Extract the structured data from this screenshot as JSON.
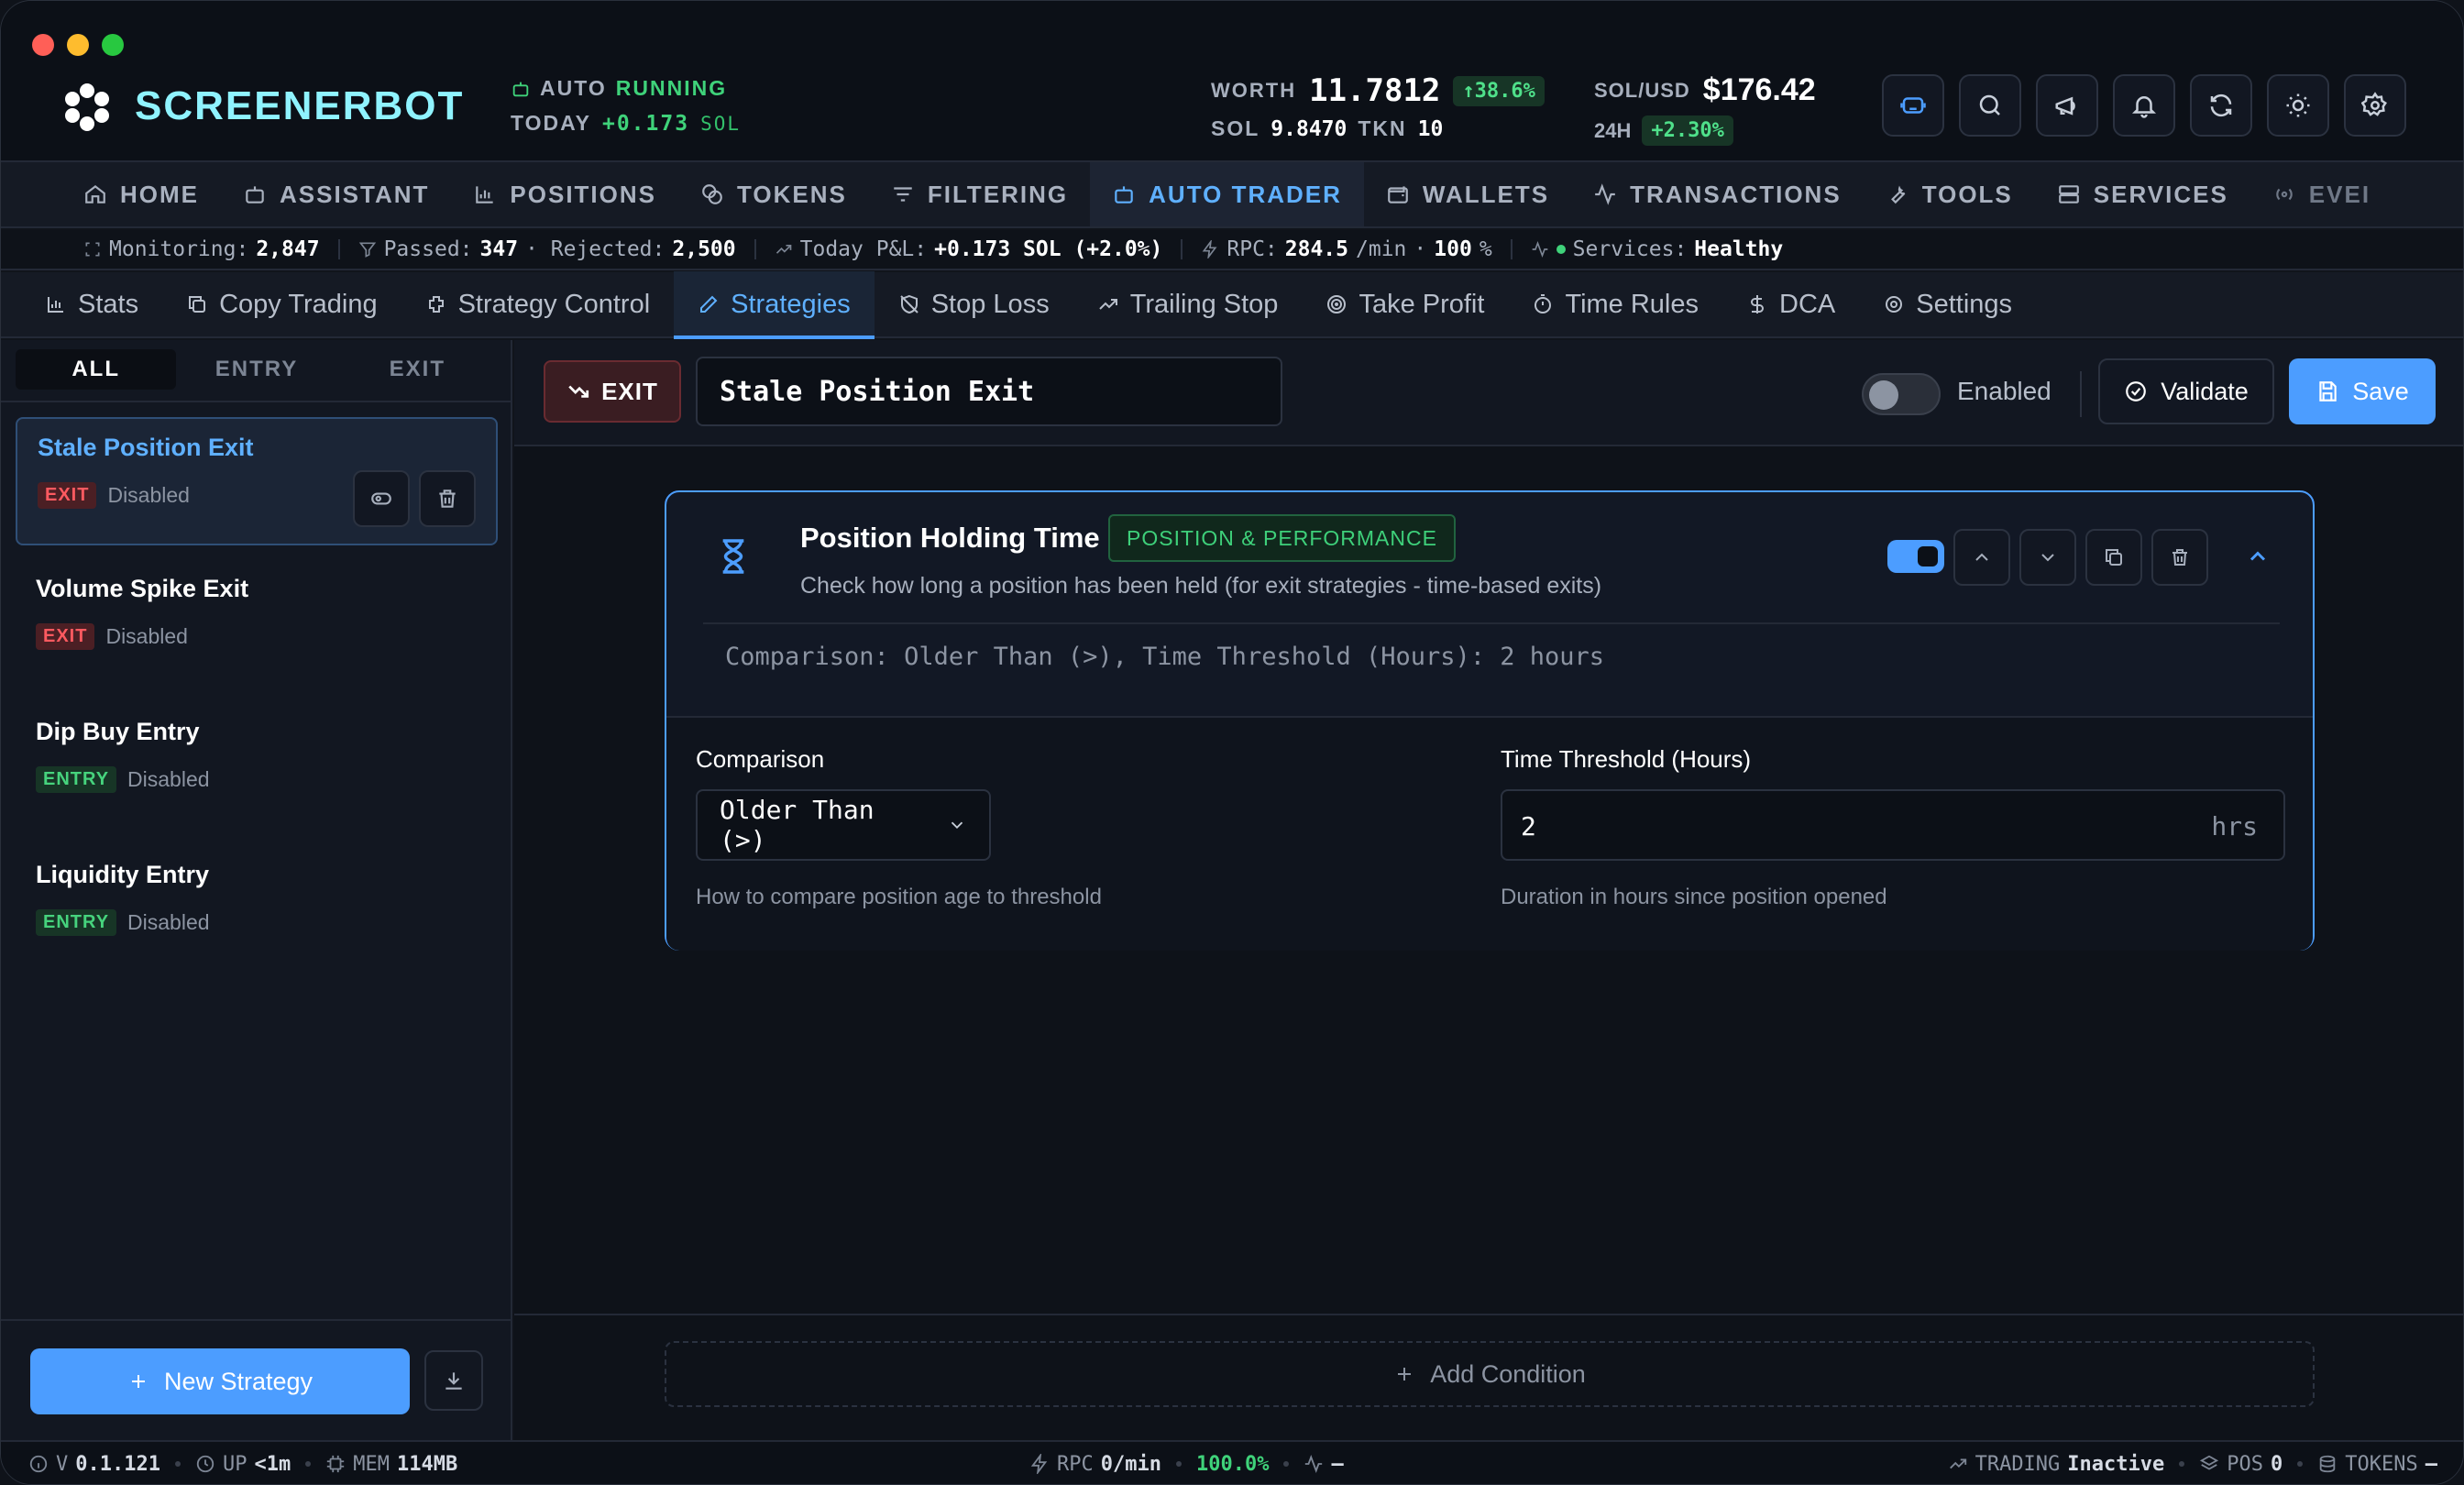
{
  "app": {
    "brand": "SCREENERBOT"
  },
  "header": {
    "auto_label": "AUTO",
    "auto_status": "RUNNING",
    "today_label": "TODAY",
    "today_value": "+0.173",
    "today_unit": "SOL",
    "worth_label": "WORTH",
    "worth_value": "11.7812",
    "worth_change": "↑38.6%",
    "sol_label": "SOL",
    "sol_value": "9.8470",
    "tkn_label": "TKN",
    "tkn_value": "10",
    "solusd_label": "SOL/USD",
    "solusd_value": "$176.42",
    "h24_label": "24H",
    "h24_change": "+2.30%",
    "tool_icons": [
      "assistant-icon",
      "search-icon",
      "megaphone-icon",
      "bell-icon",
      "refresh-icon",
      "sun-icon",
      "gear-icon"
    ]
  },
  "nav": {
    "items": [
      {
        "label": "HOME",
        "icon": "home-icon"
      },
      {
        "label": "ASSISTANT",
        "icon": "bot-icon"
      },
      {
        "label": "POSITIONS",
        "icon": "chart-icon"
      },
      {
        "label": "TOKENS",
        "icon": "coins-icon"
      },
      {
        "label": "FILTERING",
        "icon": "filter-icon"
      },
      {
        "label": "AUTO TRADER",
        "icon": "bot-icon"
      },
      {
        "label": "WALLETS",
        "icon": "wallet-icon"
      },
      {
        "label": "TRANSACTIONS",
        "icon": "activity-icon"
      },
      {
        "label": "TOOLS",
        "icon": "wrench-icon"
      },
      {
        "label": "SERVICES",
        "icon": "server-icon"
      },
      {
        "label": "EVEI",
        "icon": "radio-icon"
      }
    ],
    "active": "AUTO TRADER"
  },
  "status": {
    "monitoring_label": "Monitoring:",
    "monitoring_value": "2,847",
    "passed_label": "Passed:",
    "passed_value": "347",
    "rejected_label": "· Rejected:",
    "rejected_value": "2,500",
    "pnl_label": "Today P&L:",
    "pnl_value": "+0.173 SOL (+2.0%)",
    "rpc_label": "RPC:",
    "rpc_value": "284.5",
    "rpc_unit": "/min",
    "rpc_pct_sep": "·",
    "rpc_pct": "100",
    "rpc_pct_unit": "%",
    "services_label": "Services:",
    "services_value": "Healthy"
  },
  "subtabs": {
    "items": [
      "Stats",
      "Copy Trading",
      "Strategy Control",
      "Strategies",
      "Stop Loss",
      "Trailing Stop",
      "Take Profit",
      "Time Rules",
      "DCA",
      "Settings"
    ],
    "active": "Strategies"
  },
  "sidebar": {
    "filters": [
      "ALL",
      "ENTRY",
      "EXIT"
    ],
    "active_filter": "ALL",
    "strategies": [
      {
        "name": "Stale Position Exit",
        "type": "EXIT",
        "status": "Disabled"
      },
      {
        "name": "Volume Spike Exit",
        "type": "EXIT",
        "status": "Disabled"
      },
      {
        "name": "Dip Buy Entry",
        "type": "ENTRY",
        "status": "Disabled"
      },
      {
        "name": "Liquidity Entry",
        "type": "ENTRY",
        "status": "Disabled"
      }
    ],
    "new_strategy_label": "New Strategy"
  },
  "editor": {
    "type_label": "EXIT",
    "strategy_name": "Stale Position Exit",
    "enabled_label": "Enabled",
    "enabled": false,
    "validate_label": "Validate",
    "save_label": "Save",
    "condition": {
      "title": "Position Holding Time",
      "category": "POSITION & PERFORMANCE",
      "description": "Check how long a position has been held (for exit strategies - time-based exits)",
      "enabled": true,
      "summary": "Comparison: Older Than (>), Time Threshold (Hours): 2 hours",
      "comparison_label": "Comparison",
      "comparison_value": "Older Than (>)",
      "comparison_help": "How to compare position age to threshold",
      "threshold_label": "Time Threshold (Hours)",
      "threshold_value": "2",
      "threshold_unit": "hrs",
      "threshold_help": "Duration in hours since position opened"
    },
    "add_condition_label": "Add Condition"
  },
  "footer": {
    "version_label": "V",
    "version_value": "0.1.121",
    "uptime_label": "UP",
    "uptime_value": "<1m",
    "mem_label": "MEM",
    "mem_value": "114MB",
    "rpc_label": "RPC",
    "rpc_value": "0/min",
    "success_value": "100.0%",
    "activity_value": "–",
    "trading_label": "TRADING",
    "trading_value": "Inactive",
    "pos_label": "POS",
    "pos_value": "0",
    "tokens_label": "TOKENS",
    "tokens_value": "–"
  },
  "colors": {
    "accent": "#4c9dff",
    "success": "#3fd27a",
    "danger": "#ff5a60",
    "brand": "#8ff3ff"
  }
}
